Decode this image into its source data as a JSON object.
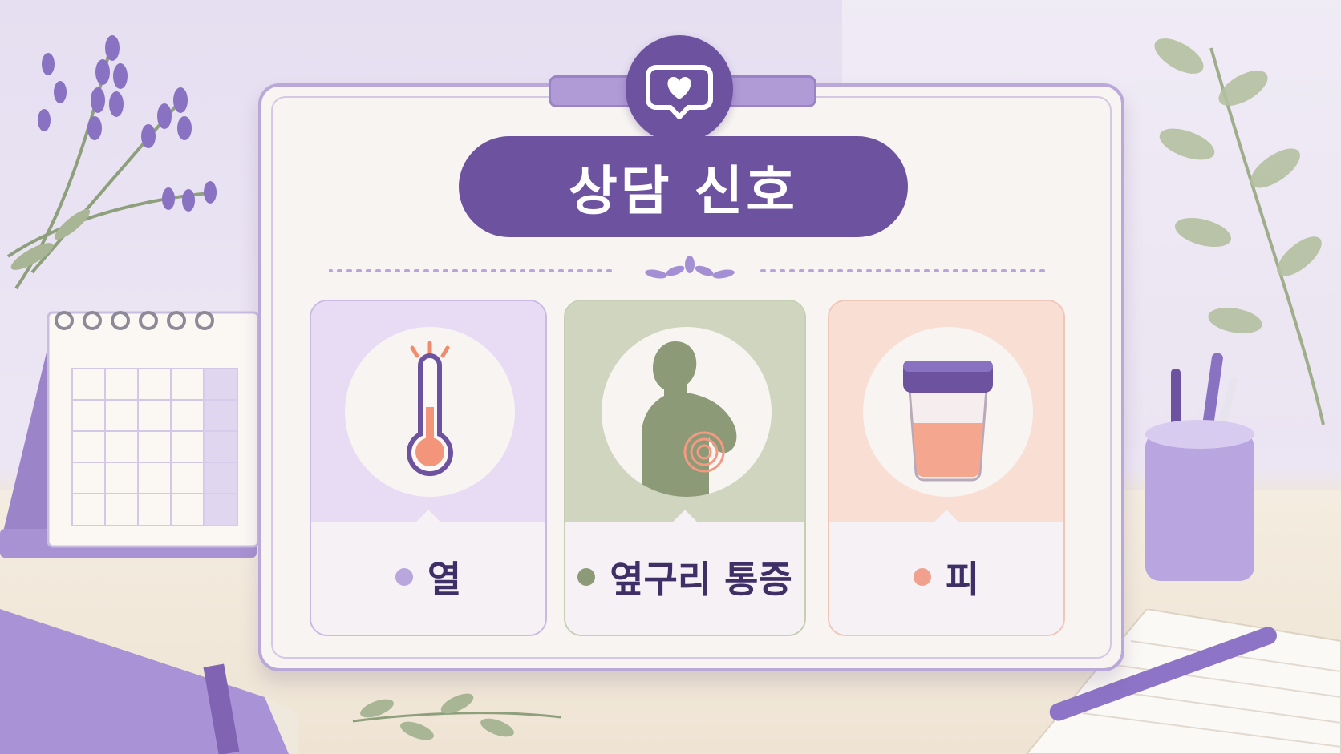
{
  "title": "상담 신호",
  "header_icon": "heart-speech-bubble-icon",
  "signals": [
    {
      "label": "열",
      "icon": "thermometer-icon",
      "accent": "#b8a6dd"
    },
    {
      "label": "옆구리 통증",
      "icon": "flank-pain-silhouette-icon",
      "accent": "#8d9a78"
    },
    {
      "label": "피",
      "icon": "specimen-cup-icon",
      "accent": "#f0a08c"
    }
  ],
  "colors": {
    "primary": "#6d52a0",
    "lavender": "#e7dcf3",
    "sage": "#cfd5bf",
    "peach": "#f9dfd3",
    "label_text": "#3e2f66"
  }
}
